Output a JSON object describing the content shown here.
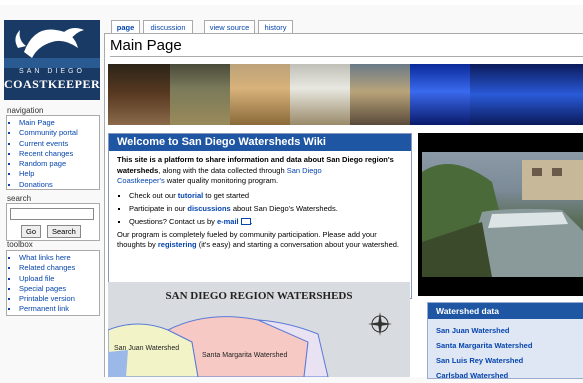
{
  "logo": {
    "line1": "SAN DIEGO",
    "line2": "COASTKEEPER"
  },
  "tabs": [
    {
      "label": "page",
      "selected": true
    },
    {
      "label": "discussion",
      "selected": false
    },
    {
      "label": "view source",
      "selected": false
    },
    {
      "label": "history",
      "selected": false
    }
  ],
  "page_title": "Main Page",
  "navigation": {
    "heading": "navigation",
    "items": [
      "Main Page",
      "Community portal",
      "Current events",
      "Recent changes",
      "Random page",
      "Help",
      "Donations"
    ]
  },
  "search": {
    "heading": "search",
    "go_label": "Go",
    "search_label": "Search",
    "value": ""
  },
  "toolbox": {
    "heading": "toolbox",
    "items": [
      "What links here",
      "Related changes",
      "Upload file",
      "Special pages",
      "Printable version",
      "Permanent link"
    ]
  },
  "welcome": {
    "heading": "Welcome to San Diego Watersheds Wiki",
    "intro_bold": "This site is a platform to share information and data about San Diego region's watersheds",
    "intro_mid": ", along with the data collected through ",
    "intro_link1": "San Diego",
    "intro_link2": "Coastkeeper's",
    "intro_end": " water quality monitoring program.",
    "b1_pre": "Check out our ",
    "b1_link": "tutorial",
    "b1_post": " to get started",
    "b2_pre": "Participate in our ",
    "b2_link": "discussions",
    "b2_post": " about San Diego's Watersheds.",
    "b3_pre": "Questions? Contact us by ",
    "b3_link": "e-mail",
    "b3_post": ".",
    "footer_pre": "Our program is completely fueled by community participation. Please add your thoughts by ",
    "footer_link": "registering",
    "footer_post": " (it's easy) and starting a conversation about your watershed."
  },
  "map": {
    "title": "SAN DIEGO REGION WATERSHEDS",
    "label1": "San Juan Watershed",
    "label2": "Santa Margarita Watershed"
  },
  "watershed_data": {
    "heading": "Watershed data",
    "items": [
      "San Juan Watershed",
      "Santa Margarita Watershed",
      "San Luis Rey Watershed",
      "Carlsbad Watershed"
    ]
  },
  "colors": {
    "accent": "#1f56a4",
    "link": "#0645ad"
  }
}
